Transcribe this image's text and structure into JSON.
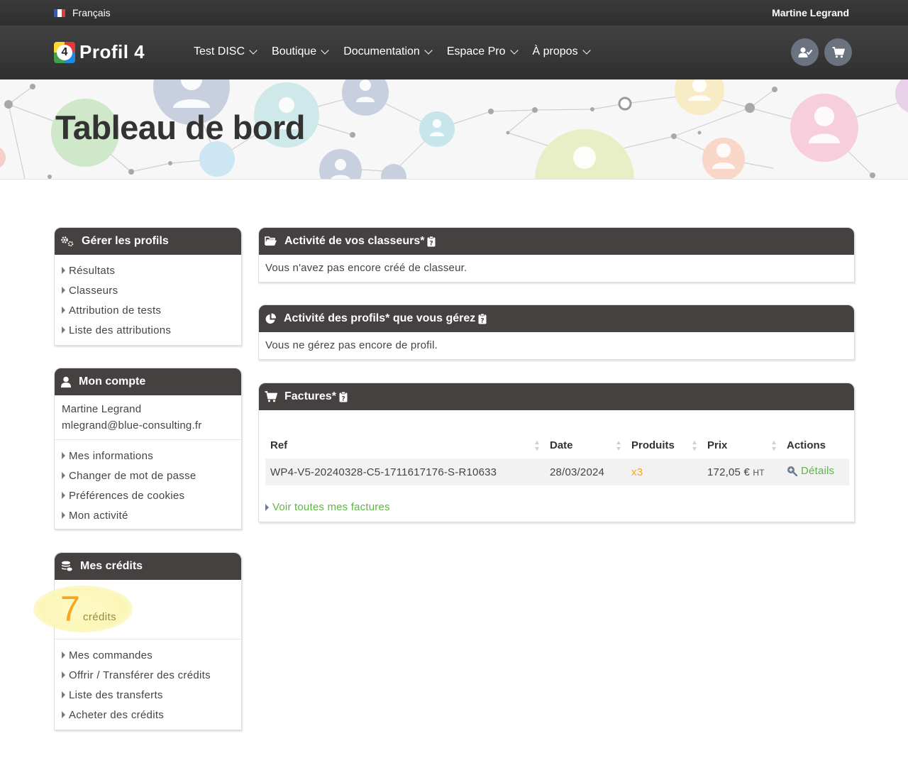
{
  "topbar": {
    "language": "Français",
    "user_name": "Martine Legrand"
  },
  "navbar": {
    "logo_text": "Profil 4",
    "logo_digit": "4",
    "menu": [
      {
        "label": "Test DISC"
      },
      {
        "label": "Boutique"
      },
      {
        "label": "Documentation"
      },
      {
        "label": "Espace Pro"
      },
      {
        "label": "À propos"
      }
    ]
  },
  "banner": {
    "title": "Tableau de bord"
  },
  "profiles_panel": {
    "title": "Gérer les profils",
    "links": [
      "Résultats",
      "Classeurs",
      "Attribution de tests",
      "Liste des attributions"
    ]
  },
  "account_panel": {
    "title": "Mon compte",
    "name": "Martine Legrand",
    "email": "mlegrand@blue-consulting.fr",
    "links": [
      "Mes informations",
      "Changer de mot de passe",
      "Préférences de cookies",
      "Mon activité"
    ]
  },
  "credits_panel": {
    "title": "Mes crédits",
    "count": "7",
    "unit": "crédits",
    "links": [
      "Mes commandes",
      "Offrir / Transférer des crédits",
      "Liste des transferts",
      "Acheter des crédits"
    ]
  },
  "binders_panel": {
    "title": "Activité de vos classeurs*",
    "message": "Vous n'avez pas encore créé de classeur."
  },
  "managed_profiles_panel": {
    "title": "Activité des profils* que vous gérez",
    "message": "Vous ne gérez pas encore de profil."
  },
  "invoices_panel": {
    "title": "Factures*",
    "columns": [
      "Ref",
      "Date",
      "Produits",
      "Prix",
      "Actions"
    ],
    "rows": [
      {
        "ref": "WP4-V5-20240328-C5-1711617176-S-R10633",
        "date": "28/03/2024",
        "products": "x3",
        "price": "172,05 €",
        "price_suffix": "HT",
        "action": "Détails"
      }
    ],
    "see_all": "Voir toutes mes factures"
  },
  "colors": {
    "accent_green": "#5fb548",
    "credits_orange": "#f5a623",
    "panel_header": "#454141",
    "nav_dark": "#333333"
  },
  "icons": [
    "flag-fr-icon",
    "chevron-down-icon",
    "user-check-icon",
    "cart-icon",
    "gears-icon",
    "user-icon",
    "coins-icon",
    "folder-open-icon",
    "pie-chart-icon",
    "clipboard-question-icon",
    "search-plus-icon",
    "caret-right-icon"
  ]
}
